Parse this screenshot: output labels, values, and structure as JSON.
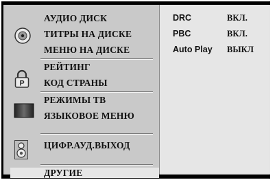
{
  "menu": {
    "groups": [
      {
        "icon": "disc-icon",
        "items": [
          "АУДИО ДИСК",
          "ТИТРЫ НА ДИСКЕ",
          "МЕНЮ НА ДИСКЕ"
        ]
      },
      {
        "icon": "padlock-icon",
        "items": [
          "РЕЙТИНГ",
          "КОД СТРАНЫ"
        ]
      },
      {
        "icon": "tv-screen-icon",
        "items": [
          "РЕЖИМЫ ТВ",
          "ЯЗЫКОВОЕ МЕНЮ"
        ]
      },
      {
        "icon": "speaker-icon",
        "items": [
          "ЦИФР.АУД.ВЫХОД"
        ]
      }
    ],
    "selected": "ДРУГИЕ"
  },
  "settings": [
    {
      "label": "DRC",
      "value": "ВКЛ."
    },
    {
      "label": "PBC",
      "value": "ВКЛ."
    },
    {
      "label": "Auto Play",
      "value": "ВЫКЛ"
    }
  ]
}
